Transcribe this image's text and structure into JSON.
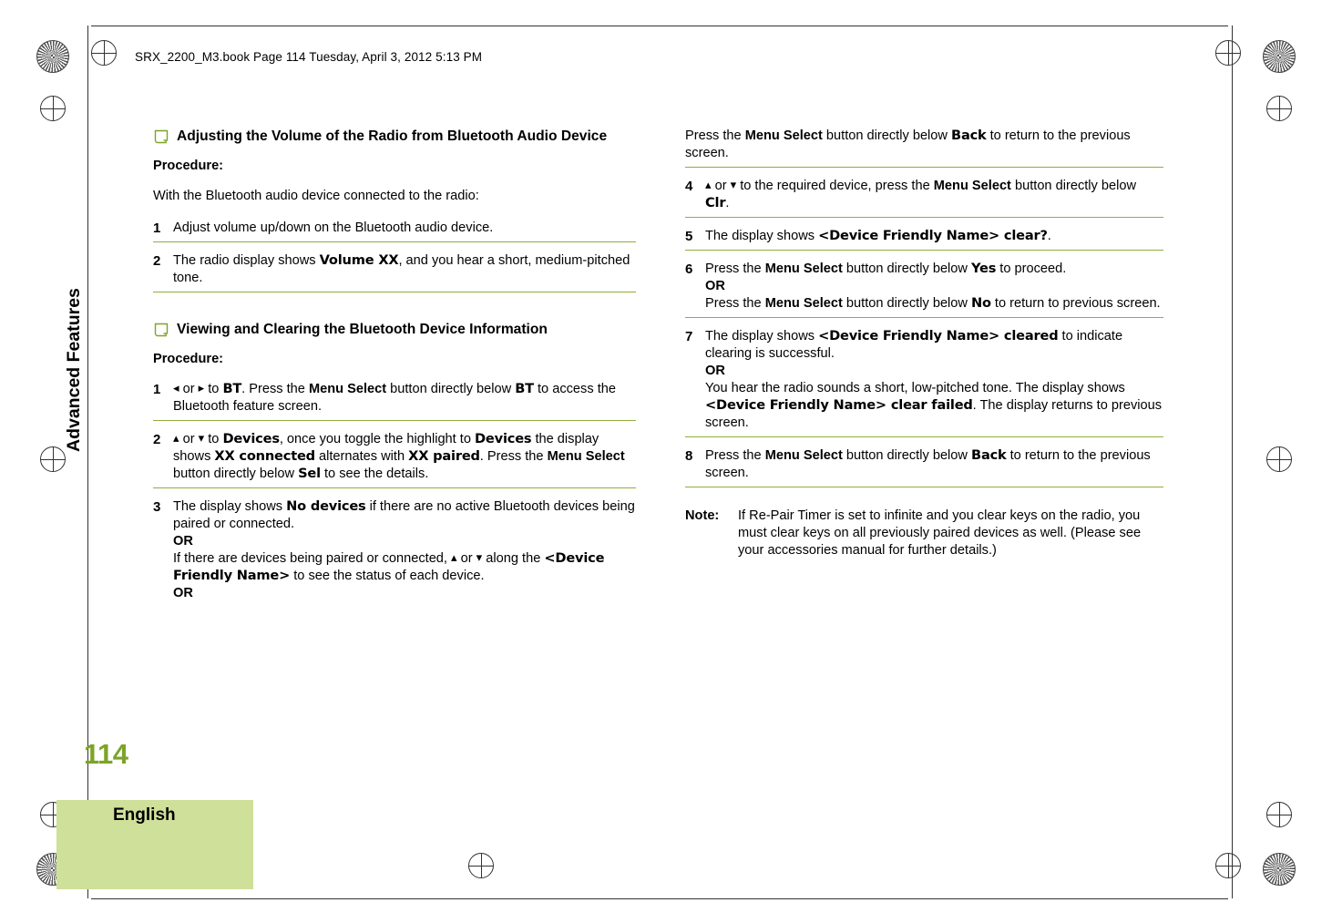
{
  "header": {
    "book_line": "SRX_2200_M3.book  Page 114  Tuesday, April 3, 2012  5:13 PM"
  },
  "sidebar": {
    "chapter": "Advanced Features",
    "page_number": "114",
    "language": "English"
  },
  "left_column": {
    "section1": {
      "icon": "book-icon",
      "title": "Adjusting the Volume of the Radio from Bluetooth Audio Device",
      "procedure_label": "Procedure:",
      "intro": "With the Bluetooth audio device connected to the radio:",
      "steps": [
        {
          "num": "1",
          "parts": [
            {
              "t": "plain",
              "v": "Adjust volume up/down on the Bluetooth audio device."
            }
          ]
        },
        {
          "num": "2",
          "parts": [
            {
              "t": "plain",
              "v": "The radio display shows "
            },
            {
              "t": "mono",
              "v": "Volume XX"
            },
            {
              "t": "plain",
              "v": ", and you hear a short, medium-pitched tone."
            }
          ]
        }
      ]
    },
    "section2": {
      "icon": "book-icon",
      "title": "Viewing and Clearing the Bluetooth Device Information",
      "procedure_label": "Procedure:",
      "steps": [
        {
          "num": "1",
          "parts": [
            {
              "t": "glyph",
              "v": "◂"
            },
            {
              "t": "plain",
              "v": " or "
            },
            {
              "t": "glyph",
              "v": "▸"
            },
            {
              "t": "plain",
              "v": " to "
            },
            {
              "t": "mono",
              "v": "BT"
            },
            {
              "t": "plain",
              "v": ". Press the "
            },
            {
              "t": "bold",
              "v": "Menu Select"
            },
            {
              "t": "plain",
              "v": " button directly below "
            },
            {
              "t": "mono",
              "v": "BT"
            },
            {
              "t": "plain",
              "v": " to access the Bluetooth feature screen."
            }
          ]
        },
        {
          "num": "2",
          "parts": [
            {
              "t": "glyph",
              "v": "▴"
            },
            {
              "t": "plain",
              "v": " or "
            },
            {
              "t": "glyph",
              "v": "▾"
            },
            {
              "t": "plain",
              "v": " to "
            },
            {
              "t": "mono",
              "v": "Devices"
            },
            {
              "t": "plain",
              "v": ", once you toggle the highlight to "
            },
            {
              "t": "mono",
              "v": "Devices"
            },
            {
              "t": "plain",
              "v": " the display shows "
            },
            {
              "t": "mono",
              "v": "XX connected"
            },
            {
              "t": "plain",
              "v": " alternates with "
            },
            {
              "t": "mono",
              "v": "XX paired"
            },
            {
              "t": "plain",
              "v": ". Press the "
            },
            {
              "t": "bold",
              "v": "Menu Select"
            },
            {
              "t": "plain",
              "v": " button directly below "
            },
            {
              "t": "mono",
              "v": "Sel"
            },
            {
              "t": "plain",
              "v": " to see the details."
            }
          ]
        },
        {
          "num": "3",
          "parts": [
            {
              "t": "plain",
              "v": "The display shows "
            },
            {
              "t": "mono",
              "v": "No devices"
            },
            {
              "t": "plain",
              "v": " if there are no active Bluetooth devices being paired or connected."
            },
            {
              "t": "or",
              "v": "OR"
            },
            {
              "t": "plain",
              "v": "If there are devices being paired or connected, "
            },
            {
              "t": "glyph",
              "v": "▴"
            },
            {
              "t": "plain",
              "v": " or "
            },
            {
              "t": "glyph",
              "v": "▾"
            },
            {
              "t": "plain",
              "v": " along the "
            },
            {
              "t": "mono",
              "v": "<Device Friendly Name>"
            },
            {
              "t": "plain",
              "v": " to see the status of each device."
            },
            {
              "t": "or",
              "v": "OR"
            }
          ]
        }
      ]
    }
  },
  "right_column": {
    "continued_step": {
      "parts": [
        {
          "t": "plain",
          "v": "Press the "
        },
        {
          "t": "bold",
          "v": "Menu Select"
        },
        {
          "t": "plain",
          "v": " button directly below "
        },
        {
          "t": "mono",
          "v": "Back"
        },
        {
          "t": "plain",
          "v": " to return to the previous screen."
        }
      ]
    },
    "steps": [
      {
        "num": "4",
        "parts": [
          {
            "t": "glyph",
            "v": "▴"
          },
          {
            "t": "plain",
            "v": " or "
          },
          {
            "t": "glyph",
            "v": "▾"
          },
          {
            "t": "plain",
            "v": " to the required device, press the "
          },
          {
            "t": "bold",
            "v": "Menu Select"
          },
          {
            "t": "plain",
            "v": " button directly below "
          },
          {
            "t": "mono",
            "v": "Clr"
          },
          {
            "t": "plain",
            "v": "."
          }
        ]
      },
      {
        "num": "5",
        "parts": [
          {
            "t": "plain",
            "v": "The display shows "
          },
          {
            "t": "mono",
            "v": "<Device Friendly Name> clear?"
          },
          {
            "t": "plain",
            "v": "."
          }
        ]
      },
      {
        "num": "6",
        "parts": [
          {
            "t": "plain",
            "v": "Press the "
          },
          {
            "t": "bold",
            "v": "Menu Select"
          },
          {
            "t": "plain",
            "v": " button directly below "
          },
          {
            "t": "mono",
            "v": "Yes"
          },
          {
            "t": "plain",
            "v": " to proceed."
          },
          {
            "t": "or",
            "v": "OR"
          },
          {
            "t": "plain",
            "v": "Press the "
          },
          {
            "t": "bold",
            "v": "Menu Select"
          },
          {
            "t": "plain",
            "v": " button directly below "
          },
          {
            "t": "mono",
            "v": "No"
          },
          {
            "t": "plain",
            "v": " to return to previous screen."
          }
        ]
      },
      {
        "num": "7",
        "parts": [
          {
            "t": "plain",
            "v": "The display shows "
          },
          {
            "t": "mono",
            "v": "<Device Friendly Name> cleared"
          },
          {
            "t": "plain",
            "v": " to indicate clearing is successful."
          },
          {
            "t": "or",
            "v": "OR"
          },
          {
            "t": "plain",
            "v": "You hear the radio sounds a short, low-pitched tone. The display shows "
          },
          {
            "t": "mono",
            "v": "<Device Friendly Name> clear failed"
          },
          {
            "t": "plain",
            "v": ". The display returns to previous screen."
          }
        ]
      },
      {
        "num": "8",
        "parts": [
          {
            "t": "plain",
            "v": "Press the "
          },
          {
            "t": "bold",
            "v": "Menu Select"
          },
          {
            "t": "plain",
            "v": " button directly below "
          },
          {
            "t": "mono",
            "v": "Back"
          },
          {
            "t": "plain",
            "v": " to return to the previous screen."
          }
        ]
      }
    ],
    "note": {
      "label": "Note:",
      "text": "If Re-Pair Timer is set to infinite and you clear keys on the radio, you must clear keys on all previously paired devices as well. (Please see your accessories manual for further details.)"
    }
  },
  "colors": {
    "rule_green": "#8fae3e",
    "accent_green": "#7ba428",
    "tab_green": "#cfe09a"
  }
}
